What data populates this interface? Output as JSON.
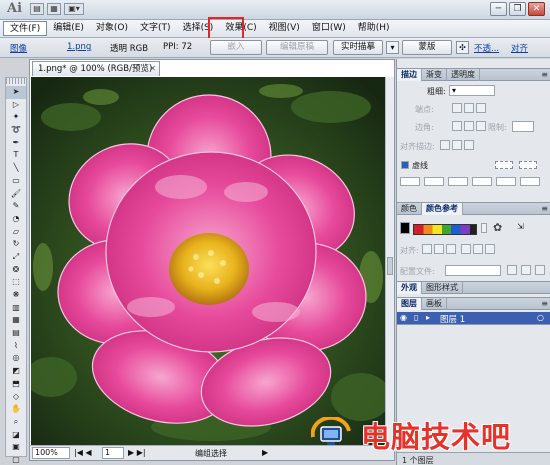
{
  "titlebar": {
    "app_logo": "Ai",
    "window_buttons": [
      "minimize",
      "restore",
      "close"
    ]
  },
  "menubar": {
    "items": [
      "文件(F)",
      "编辑(E)",
      "对象(O)",
      "文字(T)",
      "选择(S)",
      "效果(C)",
      "视图(V)",
      "窗口(W)",
      "帮助(H)"
    ],
    "highlighted": "效果(C)"
  },
  "control_bar": {
    "image_label": "图像",
    "filename": "1.png",
    "transparency": "透明 RGB",
    "ppi": "PPI: 72",
    "embed_button": "嵌入",
    "edit_original_button": "编辑原稿",
    "live_trace_button": "实时描摹",
    "mask_button": "蒙版",
    "opacity_link": "不透...",
    "align_link": "对齐"
  },
  "tools": [
    "selection",
    "direct-selection",
    "magic-wand",
    "lasso",
    "pen",
    "type",
    "line",
    "rectangle",
    "paintbrush",
    "pencil",
    "blob-brush",
    "eraser",
    "rotate",
    "scale",
    "warp",
    "free-transform",
    "symbol-sprayer",
    "column-graph",
    "mesh",
    "gradient",
    "eyedropper",
    "blend",
    "live-paint",
    "artboard",
    "slice",
    "hand",
    "zoom",
    "fill-stroke",
    "color-mode",
    "screen-mode"
  ],
  "document": {
    "tab_title": "1.png* @ 100% (RGB/预览)",
    "zoom": "100%",
    "status_label": "编组选择"
  },
  "right_panel": {
    "stroke_tabs": [
      "描边",
      "渐变",
      "透明度"
    ],
    "weight_label": "粗细:",
    "cap_label": "端点:",
    "corner_label": "边角:",
    "limit_label": "限制:",
    "align_stroke_label": "对齐描边:",
    "dashed_label": "虚线",
    "color_tabs": [
      "颜色",
      "颜色参考"
    ],
    "align_label": "对齐:",
    "preset_file_label": "配置文件:",
    "appearance_tabs": [
      "外观",
      "图形样式"
    ],
    "layer_tabs": [
      "图层",
      "画板"
    ],
    "layer_name": "图层 1",
    "layer_count": "1 个图层"
  },
  "watermark": {
    "text": "电脑技术吧"
  },
  "colors": {
    "highlight_box": "#e0262a",
    "link_blue": "#0b3ea8",
    "layer_selected": "#3c5fb0",
    "watermark_red": "#e7322b",
    "flower_pink": "#e74a9b",
    "flower_center": "#e8b21c"
  }
}
